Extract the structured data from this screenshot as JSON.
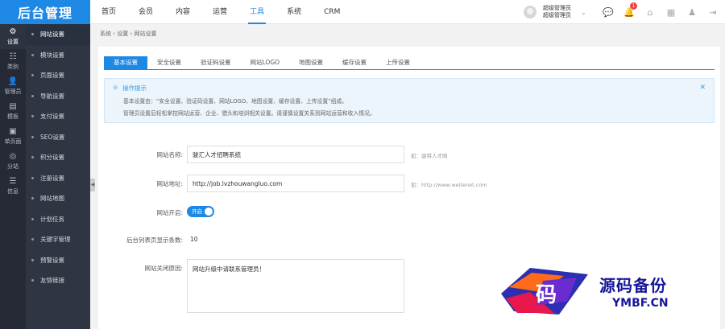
{
  "app_title": "后台管理",
  "topnav": [
    "首页",
    "会员",
    "内容",
    "运营",
    "工具",
    "系统",
    "CRM"
  ],
  "topnav_active": 4,
  "user": {
    "line1": "超级管理员",
    "line2": "超级管理员",
    "arrow": "⌄"
  },
  "top_icons": [
    {
      "name": "message-icon",
      "glyph": "💬",
      "badge": ""
    },
    {
      "name": "notification-bell-icon",
      "glyph": "🔔",
      "badge": "1"
    },
    {
      "name": "home-icon",
      "glyph": "⌂",
      "badge": ""
    },
    {
      "name": "grid-icon",
      "glyph": "▦",
      "badge": ""
    },
    {
      "name": "user-switch-icon",
      "glyph": "♟",
      "badge": ""
    },
    {
      "name": "logout-icon",
      "glyph": "⇥",
      "badge": ""
    }
  ],
  "leftbar": [
    {
      "label": "设置",
      "icon": "gear-icon",
      "glyph": "⚙"
    },
    {
      "label": "类别",
      "icon": "category-icon",
      "glyph": "☷"
    },
    {
      "label": "管理员",
      "icon": "admin-icon",
      "glyph": "👤"
    },
    {
      "label": "模板",
      "icon": "template-icon",
      "glyph": "▤"
    },
    {
      "label": "单页面",
      "icon": "page-icon",
      "glyph": "▣"
    },
    {
      "label": "分站",
      "icon": "substation-icon",
      "glyph": "◎"
    },
    {
      "label": "信息",
      "icon": "info-icon",
      "glyph": "☰"
    }
  ],
  "submenu": [
    "网站设置",
    "模块设置",
    "页面设置",
    "导航设置",
    "支付设置",
    "SEO设置",
    "积分设置",
    "注册设置",
    "网站地图",
    "计划任务",
    "关键字管理",
    "预警设置",
    "友情链接"
  ],
  "breadcrumb": "系统 › 设置 › 网站设置",
  "tabs": [
    "基本设置",
    "安全设置",
    "验证码设置",
    "网站LOGO",
    "地图设置",
    "缓存设置",
    "上传设置"
  ],
  "tip": {
    "title": "操作提示",
    "line1": "基本设置由：“安全设置、验证码设置、网站LOGO、地图设置、缓存设置、上传设置”组成。",
    "line2": "管理员设置后轻松掌控网站运营、企业、猎头和培训相关设置。请谨慎设置关系到网站运营和收入情况。",
    "close": "✕"
  },
  "form": {
    "site_name_label": "网站名称:",
    "site_name_value": "骏汇人才招聘系统",
    "site_name_hint": "如：骏特人才网",
    "site_url_label": "网站地址:",
    "site_url_value": "http://job.lvzhouwangluo.com",
    "site_url_hint": "如：http://www.weitenet.com",
    "site_open_label": "网站开启:",
    "site_open_toggle": "开启",
    "list_count_label": "后台列表页显示条数:",
    "list_count_value": "10",
    "close_reason_label": "网站关闭原因:",
    "close_reason_value": "网站升级中请联系管理员！"
  },
  "watermark": {
    "cn": "源码备份",
    "en": "YMBF.CN",
    "badge": "码"
  }
}
